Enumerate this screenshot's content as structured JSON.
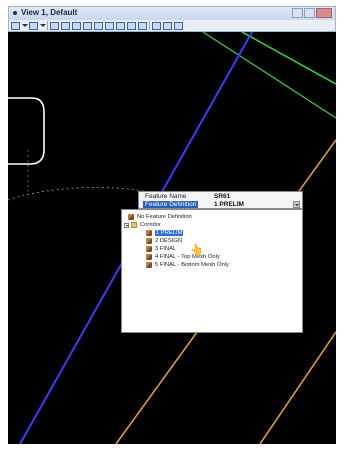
{
  "window": {
    "title": "View 1, Default"
  },
  "tooltip": {
    "name_label": "Feature Name",
    "name_value": "SR61",
    "def_label": "Feature Definition",
    "def_value": "1 PRELIM"
  },
  "tree": {
    "no_feature": "No Feature Definition",
    "folder": "Corridor",
    "items": [
      {
        "label": "1 PRELIM",
        "selected": true
      },
      {
        "label": "2 DESIGN",
        "selected": false
      },
      {
        "label": "3 FINAL",
        "selected": false
      },
      {
        "label": "4 FINAL - Top Mesh Only",
        "selected": false
      },
      {
        "label": "5 FINAL - Bottom Mesh Only",
        "selected": false
      }
    ]
  },
  "colors": {
    "background": "#000000",
    "blue_line": "#3a3cff",
    "green_line": "#35d135",
    "orange_line": "#e39a2d",
    "white_curve": "#ffffff",
    "selection": "#2a6fd9"
  }
}
